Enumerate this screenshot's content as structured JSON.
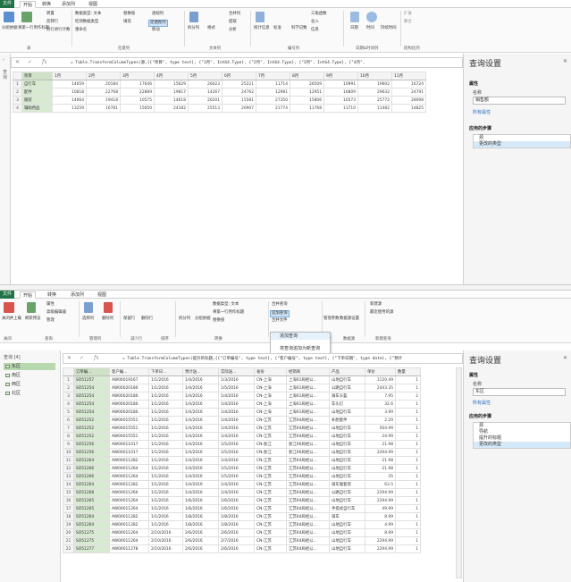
{
  "p1": {
    "tabs": [
      "文件",
      "开始",
      "转换",
      "添加列",
      "视图"
    ],
    "ribbon": {
      "btns": [
        "分组依据",
        "将第一行用作标题",
        "转置",
        "反转行",
        "对行进行计数",
        "数据类型: 文本",
        "检测数据类型",
        "重命名",
        "替换值",
        "填充",
        "透视列",
        "逆透视列",
        "移动",
        "拆分列",
        "格式",
        "合并列",
        "提取",
        "分析",
        "统计信息",
        "标准",
        "科学记数",
        "三角函数",
        "舍入",
        "信息",
        "日期",
        "时间",
        "持续时间",
        "扩展",
        "聚合"
      ],
      "groups": [
        "表",
        "任意列",
        "文本列",
        "编号列",
        "日期&时间列",
        "结构化列"
      ]
    },
    "formula": "= Table.TransformColumnTypes(源,{{\"项目\", type text}, {\"1月\", Int64.Type}, {\"2月\", Int64.Type}, {\"3月\", Int64.Type}, {\"4月\",",
    "query_label": "查询",
    "headers": [
      "项目",
      "1月",
      "2月",
      "3月",
      "4月",
      "5月",
      "6月",
      "7月",
      "8月",
      "9月",
      "10月",
      "11月"
    ],
    "rows": [
      [
        "自行车",
        "14659",
        "20184",
        "17646",
        "15629",
        "26023",
        "25221",
        "11714",
        "26509",
        "10991",
        "19602",
        "16724"
      ],
      [
        "配件",
        "10818",
        "22768",
        "22889",
        "19817",
        "14267",
        "24762",
        "12981",
        "12951",
        "16809",
        "29032",
        "24791"
      ],
      [
        "服装",
        "14664",
        "19418",
        "10575",
        "14618",
        "26201",
        "15581",
        "27350",
        "15806",
        "10573",
        "25772",
        "28098"
      ],
      [
        "辅助用品",
        "13259",
        "16781",
        "15650",
        "24182",
        "25513",
        "26907",
        "21774",
        "11768",
        "13710",
        "11482",
        "14825"
      ]
    ],
    "query_settings": {
      "title": "查询设置",
      "props": "属性",
      "name_label": "名称",
      "name_value": "销售额",
      "all_props": "所有属性",
      "applied": "应用的步骤",
      "steps": [
        "源",
        "更改的类型"
      ]
    }
  },
  "p2": {
    "tabs": [
      "文件",
      "开始",
      "转换",
      "添加列",
      "视图"
    ],
    "ribbon": {
      "btns": [
        "关闭并上载",
        "刷新预览",
        "属性",
        "高级编辑器",
        "管理",
        "选择列",
        "删除列",
        "保留行",
        "删除行",
        "拆分列",
        "分组依据",
        "数据类型: 文本",
        "将第一行用作标题",
        "替换值",
        "合并查询",
        "追加查询",
        "合并文件",
        "数据源设置",
        "管理参数",
        "新建源",
        "最近使用的源"
      ],
      "groups": [
        "关闭",
        "查询",
        "管理列",
        "减少行",
        "排序",
        "转换",
        "组合",
        "参数",
        "数据源",
        "新建查询"
      ]
    },
    "menu": [
      "追加查询",
      "将查询追加为新查询"
    ],
    "formula": "= Table.TransformColumnTypes(提升的标题,{{\"订单编号\", type text}, {\"客户编号\", type text}, {\"下单日期\", type date}, {\"预计",
    "nav_label": "查询 [4]",
    "nav": [
      "东区",
      "南区",
      "西区",
      "北区"
    ],
    "headers": [
      "订单编...",
      "客户编...",
      "下单日...",
      "预计送...",
      "实际送...",
      "省份",
      "经销商",
      "产品",
      "单价",
      "数量"
    ],
    "rows": [
      [
        "SO51257",
        "AW00019167",
        "1/1/2016",
        "1/4/2016",
        "1/3/2016",
        "CN-上海",
        "上海01局经公...",
        "山地自行车",
        "1120.49",
        "1"
      ],
      [
        "SO51254",
        "AW00020180",
        "1/1/2016",
        "1/4/2016",
        "1/5/2016",
        "CN-上海",
        "上海01局经公...",
        "公路自行车",
        "2443.35",
        "1"
      ],
      [
        "SO51254",
        "AW00020180",
        "1/1/2016",
        "1/4/2016",
        "1/4/2016",
        "CN-上海",
        "上海01局经公...",
        "骑车头盔",
        "7.95",
        "2"
      ],
      [
        "SO51254",
        "AW00020180",
        "1/1/2016",
        "1/4/2016",
        "1/4/2016",
        "CN-上海",
        "上海01局经公...",
        "车头灯",
        "32.6",
        "1"
      ],
      [
        "SO51254",
        "AW00020180",
        "1/1/2016",
        "1/4/2016",
        "1/4/2016",
        "CN-上海",
        "上海01局经公...",
        "山地自行车",
        "3.99",
        "1"
      ],
      [
        "SO51252",
        "AW00015551",
        "1/1/2016",
        "1/4/2016",
        "1/4/2016",
        "CN-江苏",
        "江苏04局经公...",
        "补胎套件",
        "2.29",
        "1"
      ],
      [
        "SO51252",
        "AW00015551",
        "1/1/2016",
        "1/4/2016",
        "1/4/2016",
        "CN-江苏",
        "江苏04局经公...",
        "山地自行车",
        "564.99",
        "1"
      ],
      [
        "SO51252",
        "AW00015551",
        "1/1/2016",
        "1/4/2016",
        "1/4/2016",
        "CN-江苏",
        "江苏04局经公...",
        "山地自行车",
        "24.99",
        "1"
      ],
      [
        "SO51256",
        "AW00011017",
        "1/1/2016",
        "1/4/2016",
        "1/5/2016",
        "CN-浙江",
        "浙江06局经公...",
        "山地自行车",
        "21.98",
        "1"
      ],
      [
        "SO51256",
        "AW00011017",
        "1/1/2016",
        "1/4/2016",
        "1/5/2016",
        "CN-浙江",
        "浙江06局经公...",
        "山地自行车",
        "2294.99",
        "1"
      ],
      [
        "SO51264",
        "AW00011282",
        "1/1/2016",
        "1/4/2016",
        "1/4/2016",
        "CN-江苏",
        "江苏04局经公...",
        "山地自行车",
        "21.98",
        "1"
      ],
      [
        "SO51266",
        "AW00011264",
        "1/1/2016",
        "1/4/2016",
        "1/5/2016",
        "CN-江苏",
        "江苏04局经公...",
        "山地自行车",
        "21.98",
        "1"
      ],
      [
        "SO51266",
        "AW00011264",
        "1/1/2016",
        "1/4/2016",
        "1/5/2016",
        "CN-江苏",
        "江苏04局经公...",
        "山地自行车",
        "35",
        "1"
      ],
      [
        "SO51264",
        "AW00011282",
        "1/1/2016",
        "1/4/2016",
        "1/4/2016",
        "CN-江苏",
        "江苏04局经公...",
        "骑车服套装",
        "63.5",
        "1"
      ],
      [
        "SO51268",
        "AW00011260",
        "1/1/2016",
        "1/4/2016",
        "1/4/2016",
        "CN-江苏",
        "江苏04局经公...",
        "公路自行车",
        "2294.99",
        "1"
      ],
      [
        "SO51265",
        "AW00011264",
        "1/1/2016",
        "1/6/2016",
        "1/6/2016",
        "CN-江苏",
        "江苏04局经公...",
        "山地自行车",
        "2294.99",
        "1"
      ],
      [
        "SO51265",
        "AW00011264",
        "1/1/2016",
        "1/6/2016",
        "1/6/2016",
        "CN-江苏",
        "江苏04局经公...",
        "手提式自行车",
        "49.99",
        "1"
      ],
      [
        "SO51264",
        "AW00011282",
        "1/1/2016",
        "1/8/2016",
        "1/8/2016",
        "CN-江苏",
        "江苏04局经公...",
        "骑车",
        "8.99",
        "1"
      ],
      [
        "SO51264",
        "AW00011282",
        "1/1/2016",
        "1/8/2016",
        "1/8/2016",
        "CN-江苏",
        "江苏04局经公...",
        "山地自行车",
        "4.99",
        "1"
      ],
      [
        "SO51275",
        "AW00011264",
        "2/10/2016",
        "2/6/2016",
        "2/6/2016",
        "CN-江苏",
        "江苏04局经公...",
        "山地自行车",
        "8.99",
        "1"
      ],
      [
        "SO51275",
        "AW00011264",
        "2/10/2016",
        "2/6/2016",
        "2/7/2016",
        "CN-江苏",
        "江苏04局经公...",
        "山地自行车",
        "2294.99",
        "1"
      ],
      [
        "SO51277",
        "AW00011278",
        "2/10/2016",
        "2/6/2016",
        "2/6/2016",
        "CN-江苏",
        "江苏04局经公...",
        "山地自行车",
        "2294.99",
        "1"
      ]
    ],
    "query_settings": {
      "title": "查询设置",
      "props": "属性",
      "name_label": "名称",
      "name_value": "东区",
      "all_props": "所有属性",
      "applied": "应用的步骤",
      "steps": [
        "源",
        "导航",
        "提升的标题",
        "更改的类型"
      ]
    }
  }
}
